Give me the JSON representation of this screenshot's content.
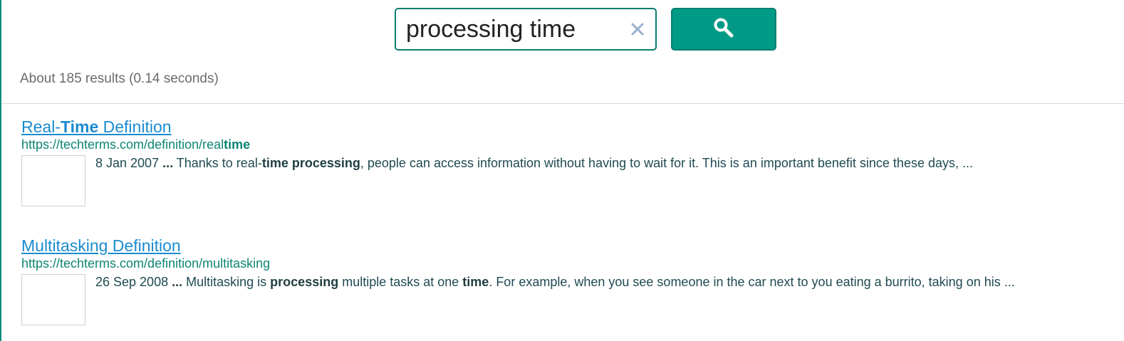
{
  "search": {
    "query": "processing time",
    "clear_icon": "close-icon",
    "button_icon": "search-icon"
  },
  "stats": {
    "text": "About 185 results (0.14 seconds)"
  },
  "results": [
    {
      "title_parts": [
        "Real-",
        "Time",
        " Definition"
      ],
      "url_parts": [
        "https://techterms.com/definition/real",
        "time"
      ],
      "snippet_parts": [
        "8 Jan 2007 ",
        "...",
        " Thanks to real-",
        "time processing",
        ", people can access information without having to wait for it. This is an important benefit since these days, ..."
      ]
    },
    {
      "title_parts": [
        "Multitasking Definition"
      ],
      "url_parts": [
        "https://techterms.com/definition/multitasking"
      ],
      "snippet_parts": [
        "26 Sep 2008 ",
        "...",
        " Multitasking is ",
        "processing",
        " multiple tasks at one ",
        "time",
        ". For example, when you see someone in the car next to you eating a burrito, taking on his ..."
      ]
    }
  ],
  "colors": {
    "accent": "#009a86",
    "link": "#1a8bd0",
    "url": "#0e8574",
    "snippet": "#1f4a52"
  }
}
